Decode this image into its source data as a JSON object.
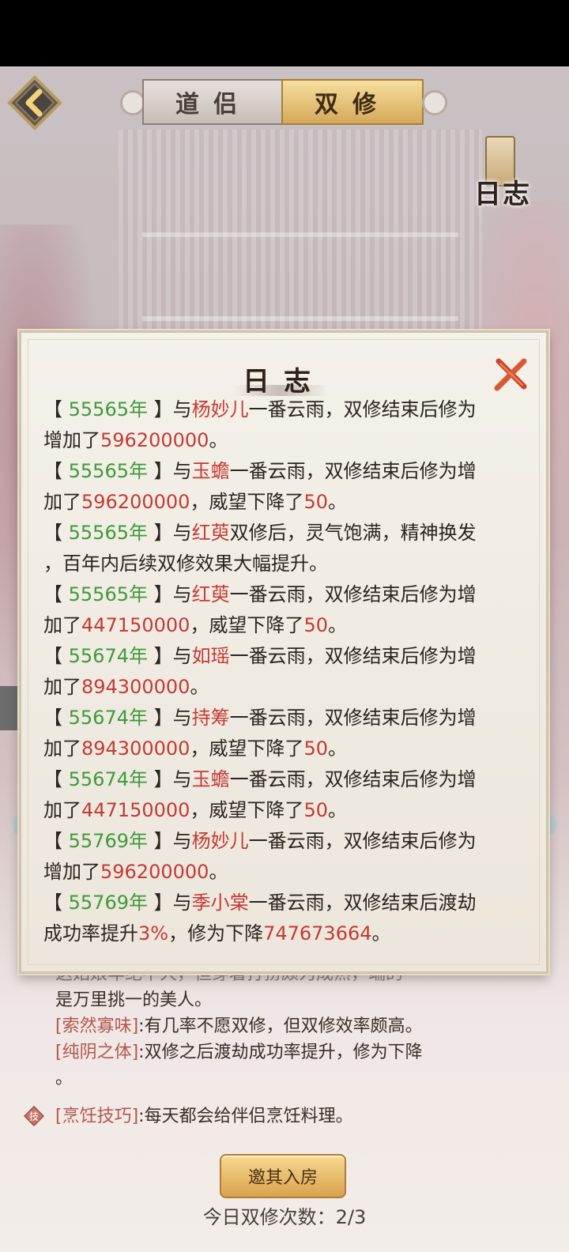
{
  "tabs": {
    "daolv": "道侣",
    "shuangxiu": "双修"
  },
  "top_log_label": "日志",
  "dialog": {
    "title": "日志",
    "lines": [
      [
        [
          "br",
          "【 "
        ],
        [
          "yr",
          "55565年"
        ],
        [
          "br",
          " 】与"
        ],
        [
          "nm",
          "杨妙儿"
        ],
        [
          "br",
          "一番云雨，双修结束后修为"
        ]
      ],
      [
        [
          "br",
          "增加了"
        ],
        [
          "num",
          "596200000"
        ],
        [
          "br",
          "。"
        ]
      ],
      [
        [
          "br",
          "【 "
        ],
        [
          "yr",
          "55565年"
        ],
        [
          "br",
          " 】与"
        ],
        [
          "nm",
          "玉蟾"
        ],
        [
          "br",
          "一番云雨，双修结束后修为增"
        ]
      ],
      [
        [
          "br",
          "加了"
        ],
        [
          "num",
          "596200000"
        ],
        [
          "br",
          "，威望下降了"
        ],
        [
          "num",
          "50"
        ],
        [
          "br",
          "。"
        ]
      ],
      [
        [
          "br",
          "【 "
        ],
        [
          "yr",
          "55565年"
        ],
        [
          "br",
          " 】与"
        ],
        [
          "nm",
          "红萸"
        ],
        [
          "br",
          "双修后，灵气饱满，精神换发"
        ]
      ],
      [
        [
          "br",
          "，百年内后续双修效果大幅提升。"
        ]
      ],
      [
        [
          "br",
          "【 "
        ],
        [
          "yr",
          "55565年"
        ],
        [
          "br",
          " 】与"
        ],
        [
          "nm",
          "红萸"
        ],
        [
          "br",
          "一番云雨，双修结束后修为增"
        ]
      ],
      [
        [
          "br",
          "加了"
        ],
        [
          "num",
          "447150000"
        ],
        [
          "br",
          "，威望下降了"
        ],
        [
          "num",
          "50"
        ],
        [
          "br",
          "。"
        ]
      ],
      [
        [
          "br",
          "【 "
        ],
        [
          "yr",
          "55674年"
        ],
        [
          "br",
          " 】与"
        ],
        [
          "nm",
          "如瑶"
        ],
        [
          "br",
          "一番云雨，双修结束后修为增"
        ]
      ],
      [
        [
          "br",
          "加了"
        ],
        [
          "num",
          "894300000"
        ],
        [
          "br",
          "。"
        ]
      ],
      [
        [
          "br",
          "【 "
        ],
        [
          "yr",
          "55674年"
        ],
        [
          "br",
          " 】与"
        ],
        [
          "nm",
          "持筹"
        ],
        [
          "br",
          "一番云雨，双修结束后修为增"
        ]
      ],
      [
        [
          "br",
          "加了"
        ],
        [
          "num",
          "894300000"
        ],
        [
          "br",
          "，威望下降了"
        ],
        [
          "num",
          "50"
        ],
        [
          "br",
          "。"
        ]
      ],
      [
        [
          "br",
          "【 "
        ],
        [
          "yr",
          "55674年"
        ],
        [
          "br",
          " 】与"
        ],
        [
          "nm",
          "玉蟾"
        ],
        [
          "br",
          "一番云雨，双修结束后修为增"
        ]
      ],
      [
        [
          "br",
          "加了"
        ],
        [
          "num",
          "447150000"
        ],
        [
          "br",
          "，威望下降了"
        ],
        [
          "num",
          "50"
        ],
        [
          "br",
          "。"
        ]
      ],
      [
        [
          "br",
          "【 "
        ],
        [
          "yr",
          "55769年"
        ],
        [
          "br",
          " 】与"
        ],
        [
          "nm",
          "杨妙儿"
        ],
        [
          "br",
          "一番云雨，双修结束后修为"
        ]
      ],
      [
        [
          "br",
          "增加了"
        ],
        [
          "num",
          "596200000"
        ],
        [
          "br",
          "。"
        ]
      ],
      [
        [
          "br",
          "【 "
        ],
        [
          "yr",
          "55769年"
        ],
        [
          "br",
          " 】与"
        ],
        [
          "nm",
          "季小棠"
        ],
        [
          "br",
          "一番云雨，双修结束后渡劫"
        ]
      ],
      [
        [
          "br",
          "成功率提升"
        ],
        [
          "num",
          "3%"
        ],
        [
          "br",
          "，修为下降"
        ],
        [
          "num",
          "747673664"
        ],
        [
          "br",
          "。"
        ]
      ]
    ]
  },
  "behind": {
    "partial_desc": "这姑娘年纪不大，但穿着打扮颇为成熟，端的",
    "desc_2": "是万里挑一的美人。",
    "trait1_name": "[索然寡味]",
    "trait1_text": ":有几率不愿双修，但双修效率颇高。",
    "trait2_name": "[纯阴之体]",
    "trait2_text": ":双修之后渡劫成功率提升，修为下降",
    "trait2_tail": "。",
    "skill_icon": "技",
    "skill_name": "[烹饪技巧]",
    "skill_text": ":每天都会给伴侣烹饪料理。"
  },
  "invite_button": "邀其入房",
  "today_count": "今日双修次数：2/3",
  "colors": {
    "year": "#3f9a3a",
    "name": "#c43a34",
    "number": "#c43a34",
    "trait": "#b5574f"
  }
}
